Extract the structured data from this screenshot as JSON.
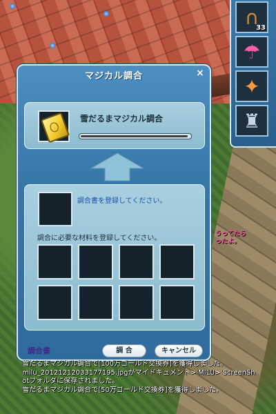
{
  "dialog": {
    "title": "マジカル調合",
    "close_label": "×",
    "target": {
      "name": "雪だるまマジカル調合",
      "progress": 0.98
    },
    "register_hint": "調合書を登録してください。",
    "materials_hint": "調合に必要な材料を登録してください。",
    "material_slots": 8,
    "footer_label": "調合書",
    "craft_button": "調 合",
    "cancel_button": "キャンセル"
  },
  "inventory": {
    "items": [
      {
        "icon": "horseshoe-icon",
        "count": "33"
      },
      {
        "icon": "pink-umbrella-icon",
        "count": ""
      },
      {
        "icon": "fire-spear-icon",
        "count": ""
      },
      {
        "icon": "tuxedo-icon",
        "count": ""
      }
    ]
  },
  "overhead": {
    "line1": "うってたら",
    "line2": "ったよ。"
  },
  "chat": [
    "雪だるまマジカル調合で[100万ゴールド交換券]を獲得しました。",
    "milu_20121212033177195.jpgがマイドキュメント> MILU> ScreenSh",
    "otフォルダに保存されました。",
    "雪だるまマジカル調合で[50万ゴールド交換券]を獲得しました。"
  ],
  "colors": {
    "dialog_blue": "#3677a8",
    "panel": "#a9cfe0",
    "hint_blue": "#1c4fb0",
    "footer_purple": "#3c2a8c"
  }
}
